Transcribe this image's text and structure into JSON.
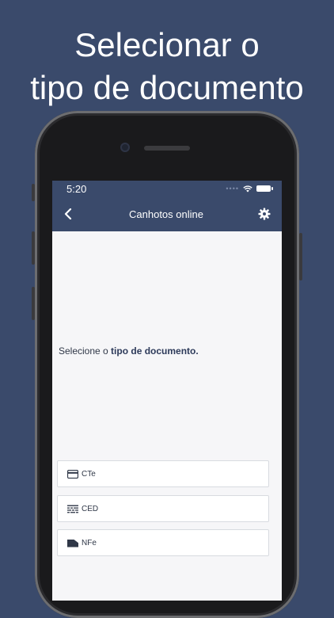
{
  "headline": {
    "line1": "Selecionar o",
    "line2": "tipo de documento"
  },
  "status_bar": {
    "time": "5:20",
    "dots": "••••"
  },
  "nav_bar": {
    "title": "Canhotos online",
    "back_icon": "chevron-left-icon",
    "settings_icon": "gear-icon"
  },
  "content": {
    "prompt_prefix": "Selecione o ",
    "prompt_bold": "tipo de documento."
  },
  "options": [
    {
      "label": "CTe",
      "icon": "card-icon"
    },
    {
      "label": "CED",
      "icon": "list-icon"
    },
    {
      "label": "NFe",
      "icon": "folder-icon"
    }
  ],
  "colors": {
    "primary": "#3a4a6b",
    "screen_bg": "#f6f6f8",
    "card_border": "#d8dbe0"
  }
}
